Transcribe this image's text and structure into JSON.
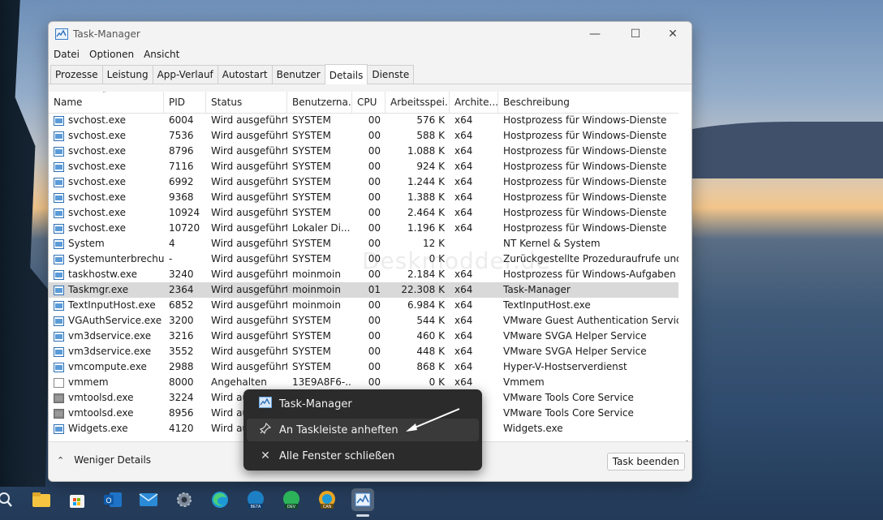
{
  "window": {
    "title": "Task-Manager",
    "menu": [
      "Datei",
      "Optionen",
      "Ansicht"
    ],
    "tabs": [
      "Prozesse",
      "Leistung",
      "App-Verlauf",
      "Autostart",
      "Benutzer",
      "Details",
      "Dienste"
    ],
    "active_tab": "Details"
  },
  "table": {
    "columns": [
      "Name",
      "PID",
      "Status",
      "Benutzerna...",
      "CPU",
      "Arbeitsspei...",
      "Archite...",
      "Beschreibung"
    ],
    "sorted_column": "Name",
    "rows": [
      {
        "name": "svchost.exe",
        "pid": "6004",
        "status": "Wird ausgeführt",
        "user": "SYSTEM",
        "cpu": "00",
        "mem": "576 K",
        "arch": "x64",
        "desc": "Hostprozess für Windows-Dienste",
        "icon": "service-icon"
      },
      {
        "name": "svchost.exe",
        "pid": "7536",
        "status": "Wird ausgeführt",
        "user": "SYSTEM",
        "cpu": "00",
        "mem": "588 K",
        "arch": "x64",
        "desc": "Hostprozess für Windows-Dienste",
        "icon": "service-icon"
      },
      {
        "name": "svchost.exe",
        "pid": "8796",
        "status": "Wird ausgeführt",
        "user": "SYSTEM",
        "cpu": "00",
        "mem": "1.088 K",
        "arch": "x64",
        "desc": "Hostprozess für Windows-Dienste",
        "icon": "service-icon"
      },
      {
        "name": "svchost.exe",
        "pid": "7116",
        "status": "Wird ausgeführt",
        "user": "SYSTEM",
        "cpu": "00",
        "mem": "924 K",
        "arch": "x64",
        "desc": "Hostprozess für Windows-Dienste",
        "icon": "service-icon"
      },
      {
        "name": "svchost.exe",
        "pid": "6992",
        "status": "Wird ausgeführt",
        "user": "SYSTEM",
        "cpu": "00",
        "mem": "1.244 K",
        "arch": "x64",
        "desc": "Hostprozess für Windows-Dienste",
        "icon": "service-icon"
      },
      {
        "name": "svchost.exe",
        "pid": "9368",
        "status": "Wird ausgeführt",
        "user": "SYSTEM",
        "cpu": "00",
        "mem": "1.388 K",
        "arch": "x64",
        "desc": "Hostprozess für Windows-Dienste",
        "icon": "service-icon"
      },
      {
        "name": "svchost.exe",
        "pid": "10924",
        "status": "Wird ausgeführt",
        "user": "SYSTEM",
        "cpu": "00",
        "mem": "2.464 K",
        "arch": "x64",
        "desc": "Hostprozess für Windows-Dienste",
        "icon": "service-icon"
      },
      {
        "name": "svchost.exe",
        "pid": "10720",
        "status": "Wird ausgeführt",
        "user": "Lokaler Di...",
        "cpu": "00",
        "mem": "1.196 K",
        "arch": "x64",
        "desc": "Hostprozess für Windows-Dienste",
        "icon": "service-icon"
      },
      {
        "name": "System",
        "pid": "4",
        "status": "Wird ausgeführt",
        "user": "SYSTEM",
        "cpu": "00",
        "mem": "12 K",
        "arch": "",
        "desc": "NT Kernel & System",
        "icon": "service-icon"
      },
      {
        "name": "Systemunterbrechun...",
        "pid": "-",
        "status": "Wird ausgeführt",
        "user": "SYSTEM",
        "cpu": "00",
        "mem": "0 K",
        "arch": "",
        "desc": "Zurückgestellte Prozeduraufrufe und ...",
        "icon": "service-icon"
      },
      {
        "name": "taskhostw.exe",
        "pid": "3240",
        "status": "Wird ausgeführt",
        "user": "moinmoin",
        "cpu": "00",
        "mem": "2.184 K",
        "arch": "x64",
        "desc": "Hostprozess für Windows-Aufgaben",
        "icon": "service-icon"
      },
      {
        "name": "Taskmgr.exe",
        "pid": "2364",
        "status": "Wird ausgeführt",
        "user": "moinmoin",
        "cpu": "01",
        "mem": "22.308 K",
        "arch": "x64",
        "desc": "Task-Manager",
        "icon": "task-manager-icon",
        "selected": true
      },
      {
        "name": "TextInputHost.exe",
        "pid": "6852",
        "status": "Wird ausgeführt",
        "user": "moinmoin",
        "cpu": "00",
        "mem": "6.984 K",
        "arch": "x64",
        "desc": "TextInputHost.exe",
        "icon": "service-icon"
      },
      {
        "name": "VGAuthService.exe",
        "pid": "3200",
        "status": "Wird ausgeführt",
        "user": "SYSTEM",
        "cpu": "00",
        "mem": "544 K",
        "arch": "x64",
        "desc": "VMware Guest Authentication Service",
        "icon": "service-icon"
      },
      {
        "name": "vm3dservice.exe",
        "pid": "3216",
        "status": "Wird ausgeführt",
        "user": "SYSTEM",
        "cpu": "00",
        "mem": "460 K",
        "arch": "x64",
        "desc": "VMware SVGA Helper Service",
        "icon": "service-icon"
      },
      {
        "name": "vm3dservice.exe",
        "pid": "3552",
        "status": "Wird ausgeführt",
        "user": "SYSTEM",
        "cpu": "00",
        "mem": "448 K",
        "arch": "x64",
        "desc": "VMware SVGA Helper Service",
        "icon": "service-icon"
      },
      {
        "name": "vmcompute.exe",
        "pid": "2988",
        "status": "Wird ausgeführt",
        "user": "SYSTEM",
        "cpu": "00",
        "mem": "868 K",
        "arch": "x64",
        "desc": "Hyper-V-Hostserverdienst",
        "icon": "service-icon"
      },
      {
        "name": "vmmem",
        "pid": "8000",
        "status": "Angehalten",
        "user": "13E9A8F6-...",
        "cpu": "00",
        "mem": "0 K",
        "arch": "x64",
        "desc": "Vmmem",
        "icon": "document-icon"
      },
      {
        "name": "vmtoolsd.exe",
        "pid": "3224",
        "status": "Wird au",
        "user": "",
        "cpu": "",
        "mem": "",
        "arch": "",
        "desc": "VMware Tools Core Service",
        "icon": "vmware-icon"
      },
      {
        "name": "vmtoolsd.exe",
        "pid": "8956",
        "status": "Wird au",
        "user": "",
        "cpu": "",
        "mem": "",
        "arch": "",
        "desc": "VMware Tools Core Service",
        "icon": "vmware-icon"
      },
      {
        "name": "Widgets.exe",
        "pid": "4120",
        "status": "Wird au",
        "user": "",
        "cpu": "",
        "mem": "",
        "arch": "",
        "desc": "Widgets.exe",
        "icon": "service-icon"
      }
    ]
  },
  "footer": {
    "fewer_details": "Weniger Details",
    "end_task": "Task beenden"
  },
  "context_menu": {
    "items": [
      {
        "label": "Task-Manager",
        "icon": "task-manager-icon"
      },
      {
        "label": "An Taskleiste anheften",
        "icon": "pin-icon"
      },
      {
        "label": "Alle Fenster schließen",
        "icon": "close-icon"
      }
    ]
  },
  "watermark": "Deskmodder.de",
  "taskbar": {
    "icons": [
      "search-icon",
      "file-explorer-icon",
      "store-icon",
      "outlook-icon",
      "mail-icon",
      "settings-icon",
      "edge-icon",
      "edge-beta-icon",
      "edge-dev-icon",
      "edge-canary-icon",
      "task-manager-icon"
    ],
    "badges": {
      "beta": "BETA",
      "dev": "DEV",
      "can": "CAN"
    }
  }
}
